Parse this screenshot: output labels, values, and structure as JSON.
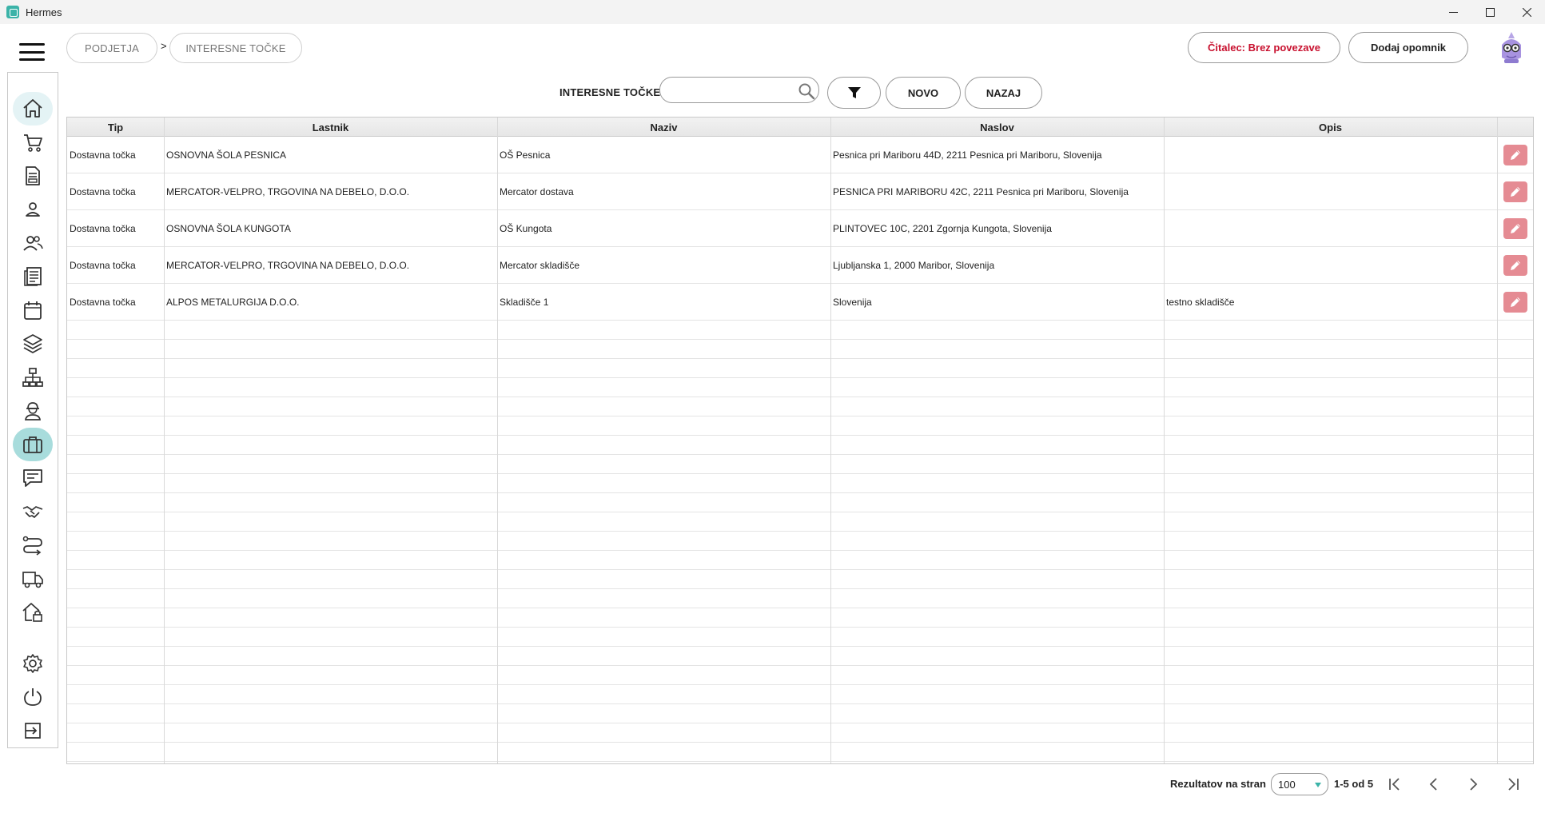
{
  "window": {
    "title": "Hermes"
  },
  "breadcrumb": {
    "items": [
      "PODJETJA",
      "INTERESNE TOČKE"
    ],
    "separator": ">"
  },
  "header": {
    "reader_status": "Čitalec: Brez povezave",
    "add_reminder": "Dodaj opomnik"
  },
  "toolbar": {
    "label": "INTERESNE TOČKE",
    "search_value": "",
    "new_button": "NOVO",
    "back_button": "NAZAJ"
  },
  "sidebar": {
    "items": [
      "home-icon",
      "cart-icon",
      "document-icon",
      "person-icon",
      "people-icon",
      "news-icon",
      "calendar-icon",
      "layers-icon",
      "network-icon",
      "worker-icon",
      "briefcase-icon",
      "chat-icon",
      "handshake-icon",
      "route-icon",
      "truck-icon",
      "warehouse-icon",
      "gear-icon",
      "power-icon",
      "logout-icon"
    ],
    "active": "briefcase-icon"
  },
  "table": {
    "columns": [
      "Tip",
      "Lastnik",
      "Naziv",
      "Naslov",
      "Opis"
    ],
    "rows": [
      {
        "tip": "Dostavna točka",
        "lastnik": "OSNOVNA ŠOLA PESNICA",
        "naziv": "OŠ Pesnica",
        "naslov": "Pesnica pri Mariboru 44D, 2211 Pesnica pri Mariboru, Slovenija",
        "opis": ""
      },
      {
        "tip": "Dostavna točka",
        "lastnik": "MERCATOR-VELPRO, TRGOVINA NA DEBELO, D.O.O.",
        "naziv": "Mercator dostava",
        "naslov": "PESNICA PRI MARIBORU 42C, 2211 Pesnica pri Mariboru, Slovenija",
        "opis": ""
      },
      {
        "tip": "Dostavna točka",
        "lastnik": "OSNOVNA ŠOLA KUNGOTA",
        "naziv": "OŠ Kungota",
        "naslov": "PLINTOVEC 10C, 2201 Zgornja Kungota, Slovenija",
        "opis": ""
      },
      {
        "tip": "Dostavna točka",
        "lastnik": "MERCATOR-VELPRO, TRGOVINA NA DEBELO, D.O.O.",
        "naziv": "Mercator skladišče",
        "naslov": "Ljubljanska 1, 2000 Maribor, Slovenija",
        "opis": ""
      },
      {
        "tip": "Dostavna točka",
        "lastnik": "ALPOS METALURGIJA D.O.O.",
        "naziv": "Skladišče 1",
        "naslov": "Slovenija",
        "opis": "testno skladišče"
      }
    ]
  },
  "pagination": {
    "label": "Rezultatov na stran",
    "page_size": "100",
    "range": "1-5 od 5"
  },
  "colors": {
    "accent": "#3bb3a8",
    "active_nav": "#a8dcdc",
    "edit_button": "#e58b93",
    "reader_red": "#c8102e"
  }
}
